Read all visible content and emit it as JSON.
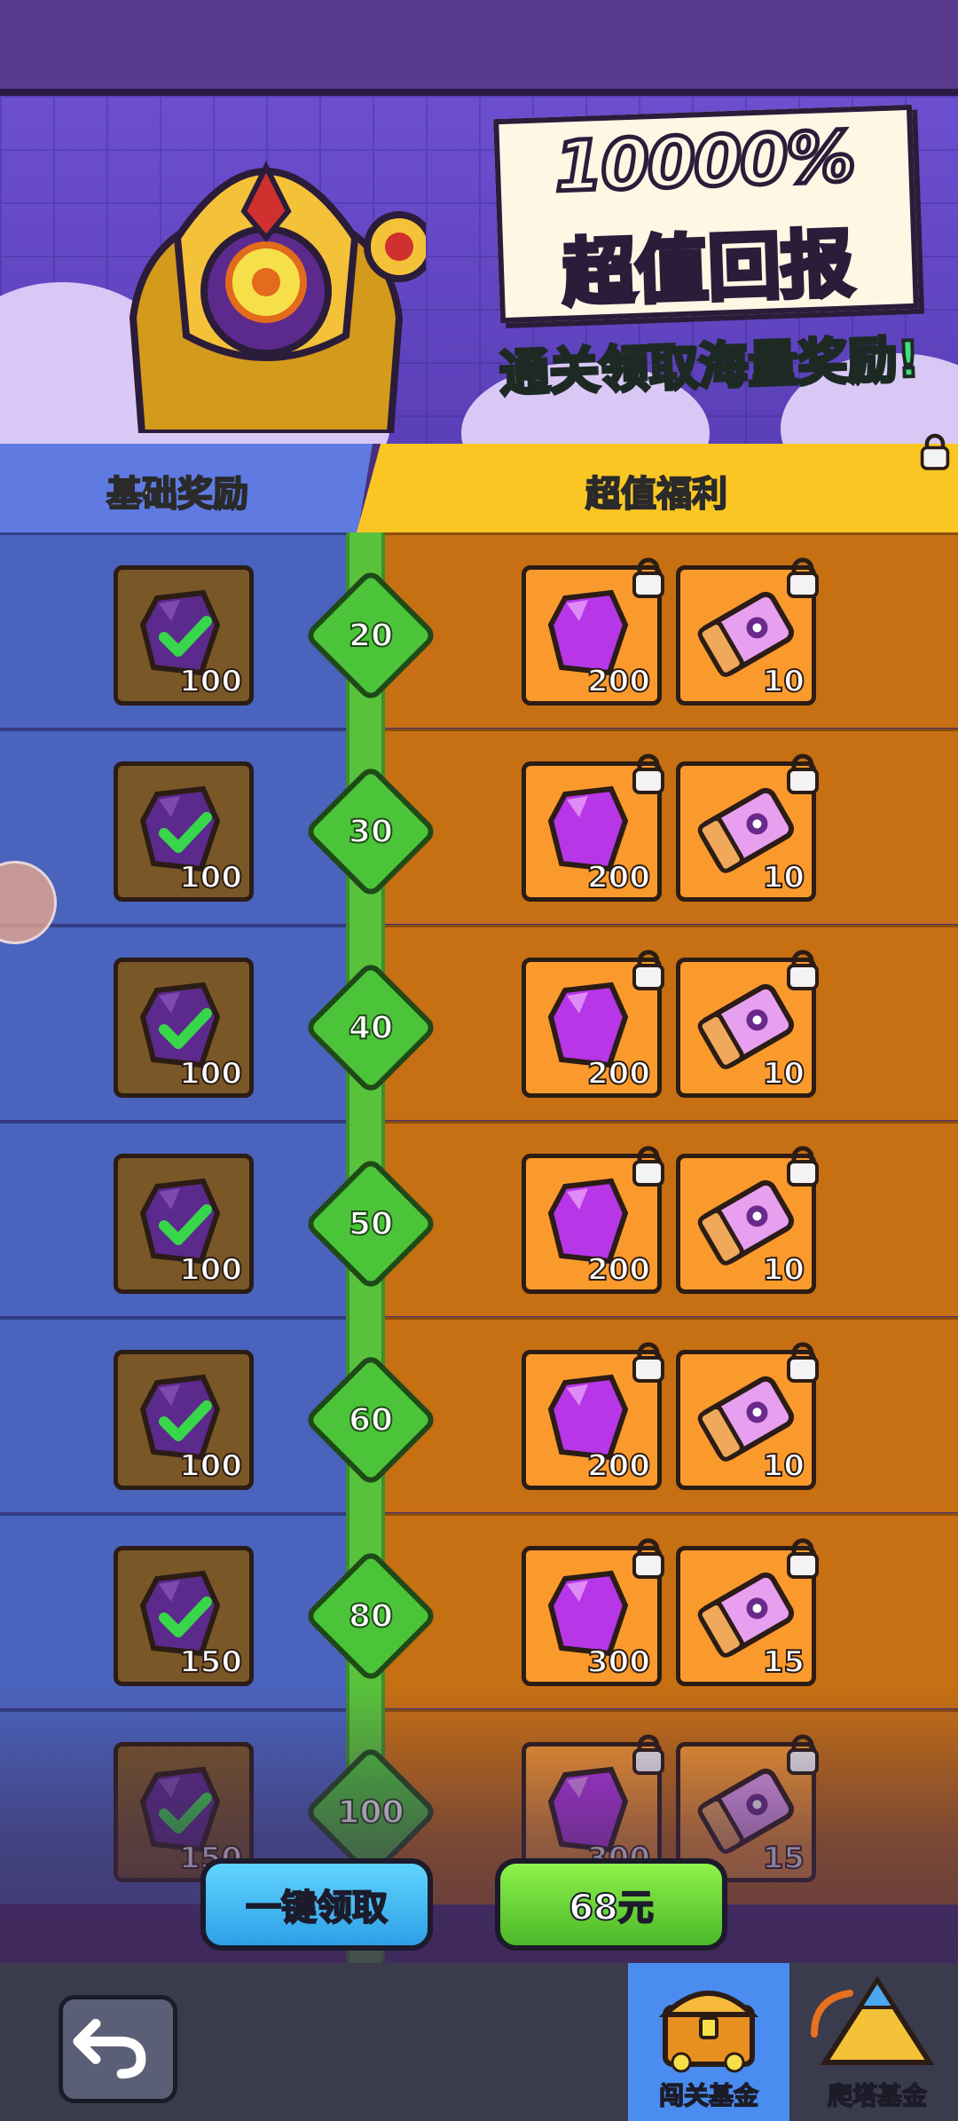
{
  "banner": {
    "title_line1": "10000%",
    "title_line2": "超值回报",
    "subtitle": "通关领取海量奖励!"
  },
  "tabs": {
    "basic_label": "基础奖励",
    "premium_label": "超值福利"
  },
  "rows": [
    {
      "level": "20",
      "basic_qty": "100",
      "gem_qty": "200",
      "ticket_qty": "10"
    },
    {
      "level": "30",
      "basic_qty": "100",
      "gem_qty": "200",
      "ticket_qty": "10"
    },
    {
      "level": "40",
      "basic_qty": "100",
      "gem_qty": "200",
      "ticket_qty": "10"
    },
    {
      "level": "50",
      "basic_qty": "100",
      "gem_qty": "200",
      "ticket_qty": "10"
    },
    {
      "level": "60",
      "basic_qty": "100",
      "gem_qty": "200",
      "ticket_qty": "10"
    },
    {
      "level": "80",
      "basic_qty": "150",
      "gem_qty": "300",
      "ticket_qty": "15"
    },
    {
      "level": "100",
      "basic_qty": "150",
      "gem_qty": "300",
      "ticket_qty": "15"
    }
  ],
  "buttons": {
    "claim_all": "一键领取",
    "price": "68元"
  },
  "bottom_nav": {
    "tab1_label": "闯关基金",
    "tab2_label": "爬塔基金"
  },
  "icons": {
    "basic_reward": "purple-gem-claimed-icon",
    "premium_gem": "purple-gem-icon",
    "premium_ticket": "pink-ticket-icon",
    "locked": "lock-icon",
    "back": "back-arrow-icon"
  },
  "colors": {
    "basic_column": "#4a63bd",
    "premium_column": "#c66f13",
    "premium_tab": "#f9c623",
    "track": "#58c23b"
  }
}
